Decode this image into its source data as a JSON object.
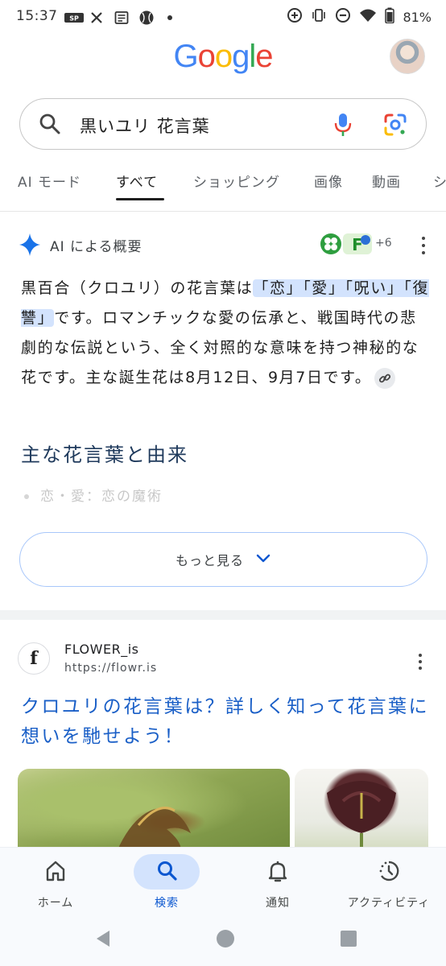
{
  "status_bar": {
    "time": "15:37",
    "battery": "81%",
    "notification_icons": [
      "sports-app-icon",
      "x-icon",
      "news-icon",
      "baseball-icon",
      "dot-icon"
    ],
    "system_icons": [
      "data-saver-icon",
      "vibrate-icon",
      "dnd-icon",
      "wifi-icon",
      "battery-icon"
    ]
  },
  "header": {
    "logo_text": "Google",
    "logo_colors": [
      "#4285f4",
      "#ea4335",
      "#fbbc05",
      "#4285f4",
      "#34a853",
      "#ea4335"
    ]
  },
  "search": {
    "query": "黒いユリ 花言葉"
  },
  "tabs": [
    {
      "label": "AI モード"
    },
    {
      "label": "すべて",
      "active": true
    },
    {
      "label": "ショッピング"
    },
    {
      "label": "画像"
    },
    {
      "label": "動画"
    },
    {
      "label": "シ"
    }
  ],
  "ai_overview": {
    "title": "AI による概要",
    "source_count": "+6",
    "body": {
      "part1": "黒百合（クロユリ）の花言葉は",
      "highlight1": "「恋」「愛」「呪い」「復讐」",
      "part2": "です。ロマンチックな愛の伝承と、戦国時代の悲劇的な伝説という、全く対照的な意味を持つ神秘的な花です。主な誕生花は8月12日、9月7日です。"
    },
    "section_title": "主な花言葉と由来",
    "faded_item": "恋・愛：恋の魔術",
    "show_more_label": "もっと見る"
  },
  "result": {
    "site_name": "FLOWER_is",
    "url": "https://flowr.is",
    "favicon_letter": "f",
    "title": "クロユリの花言葉は？詳しく知って花言葉に想いを馳せよう！"
  },
  "bottom_nav": [
    {
      "label": "ホーム",
      "icon": "home-icon"
    },
    {
      "label": "検索",
      "icon": "search-icon",
      "active": true
    },
    {
      "label": "通知",
      "icon": "bell-icon"
    },
    {
      "label": "アクティビティ",
      "icon": "activity-icon"
    }
  ],
  "colors": {
    "accent_blue": "#0b57d0",
    "highlight": "#d3e3fd",
    "link_blue": "#1a5fc7"
  }
}
